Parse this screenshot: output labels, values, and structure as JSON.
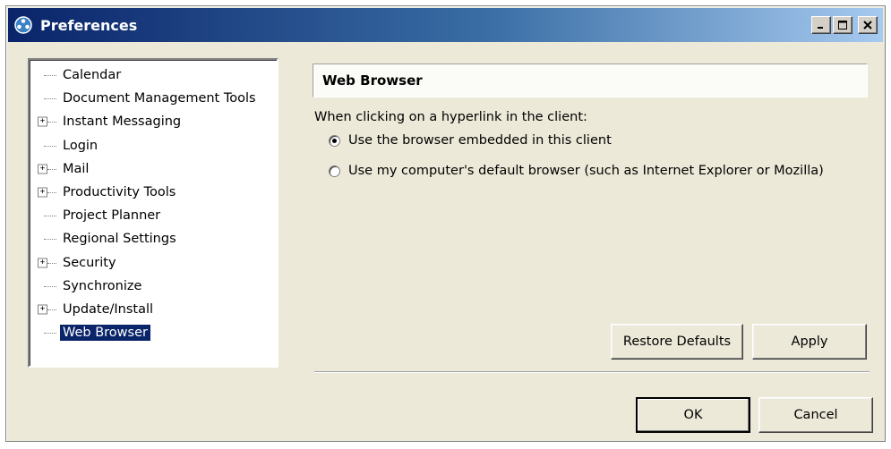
{
  "window": {
    "title": "Preferences",
    "controls": {
      "minimize": "_",
      "maximize": "□",
      "close": "×"
    }
  },
  "tree": {
    "items": [
      {
        "label": "Calendar",
        "expandable": false,
        "selected": false
      },
      {
        "label": "Document Management Tools",
        "expandable": false,
        "selected": false
      },
      {
        "label": "Instant Messaging",
        "expandable": true,
        "selected": false
      },
      {
        "label": "Login",
        "expandable": false,
        "selected": false
      },
      {
        "label": "Mail",
        "expandable": true,
        "selected": false
      },
      {
        "label": "Productivity Tools",
        "expandable": true,
        "selected": false
      },
      {
        "label": "Project Planner",
        "expandable": false,
        "selected": false
      },
      {
        "label": "Regional Settings",
        "expandable": false,
        "selected": false
      },
      {
        "label": "Security",
        "expandable": true,
        "selected": false
      },
      {
        "label": "Synchronize",
        "expandable": false,
        "selected": false
      },
      {
        "label": "Update/Install",
        "expandable": true,
        "selected": false
      },
      {
        "label": "Web Browser",
        "expandable": false,
        "selected": true
      }
    ]
  },
  "panel": {
    "title": "Web Browser",
    "prompt": "When clicking on a hyperlink in the client:",
    "options": [
      {
        "label": "Use the browser embedded in this client",
        "checked": true
      },
      {
        "label": "Use my computer's default browser (such as Internet Explorer or Mozilla)",
        "checked": false
      }
    ],
    "restore_defaults_label": "Restore Defaults",
    "apply_label": "Apply"
  },
  "footer": {
    "ok_label": "OK",
    "cancel_label": "Cancel"
  },
  "colors": {
    "titlebar_start": "#0a246a",
    "titlebar_end": "#a6caf0",
    "selection": "#0a246a",
    "window_bg": "#ece9d8"
  }
}
